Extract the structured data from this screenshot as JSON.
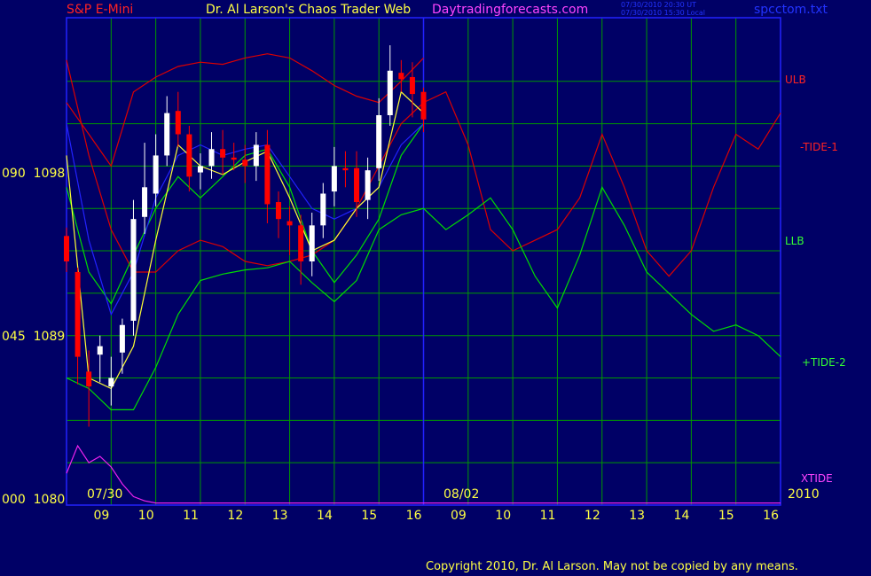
{
  "header": {
    "left": "S&P E-Mini",
    "title": "Dr. Al Larson's Chaos Trader Web",
    "site": "Daytradingforecasts.com",
    "stamp_ut": "07/30/2010 20:30 UT",
    "stamp_local": "07/30/2010 15:30 Local",
    "file": "spcctom.txt"
  },
  "footer": {
    "copyright": "Copyright 2010, Dr. Al Larson. May not be copied by any means."
  },
  "colors": {
    "background": "#000066",
    "grid": "#009900",
    "price_up": "#ffffff",
    "price_down": "#ff0000",
    "blue": "#2222ff",
    "ulb": "#dd0000",
    "llb": "#00dd00",
    "xtide": "#ee22ee",
    "moving_avg": "#ffff33"
  },
  "chart_data": {
    "type": "line",
    "title": "S&P E-Mini",
    "y_axis": {
      "range": [
        1080,
        1103
      ],
      "labels": [
        {
          "tide": "090",
          "price": "1098",
          "value": 1098
        },
        {
          "tide": "045",
          "price": "1089",
          "value": 1089
        },
        {
          "tide": "000",
          "price": "1080",
          "value": 1080
        }
      ]
    },
    "x_axis": {
      "ticks": [
        "09",
        "10",
        "11",
        "12",
        "13",
        "14",
        "15",
        "16",
        "09",
        "10",
        "11",
        "12",
        "13",
        "14",
        "15",
        "16"
      ],
      "dates": [
        "07/30",
        "08/02"
      ],
      "year": "2010"
    },
    "series_labels": [
      "ULB",
      "-TIDE-1",
      "LLB",
      "+TIDE-2",
      "XTIDE"
    ],
    "series": [
      {
        "name": "ULB",
        "x": [
          0,
          0.5,
          1,
          1.5,
          2,
          2.5,
          3,
          3.5,
          4,
          4.5,
          5,
          5.5,
          6,
          6.5,
          7,
          7.5,
          8,
          8.5,
          9,
          9.5,
          10,
          10.5,
          11,
          11.5,
          12,
          12.5,
          13,
          13.5,
          14,
          14.5,
          15,
          15.5,
          16
        ],
        "values": [
          1101,
          1096.5,
          1093,
          1091,
          1091,
          1092,
          1092.5,
          1092.2,
          1091.5,
          1091.3,
          1091.5,
          1091.8,
          1092.5,
          1094,
          1096,
          1098,
          1099,
          1099.5,
          1097,
          1093,
          1092,
          1092.5,
          1093,
          1094.5,
          1097.5,
          1095,
          1092,
          1090.8,
          1092,
          1095,
          1097.5,
          1096.8,
          1098.5
        ]
      },
      {
        "name": "-TIDE-1",
        "x": [
          0,
          0.5,
          1,
          1.5,
          2,
          2.5,
          3,
          3.5,
          4,
          4.5,
          5,
          5.5,
          6,
          6.5,
          7,
          7.5,
          8
        ],
        "values": [
          1099,
          1097.5,
          1096,
          1099.5,
          1100.2,
          1100.7,
          1100.9,
          1100.8,
          1101.1,
          1101.3,
          1101.1,
          1100.5,
          1099.8,
          1099.3,
          1099,
          1100,
          1101.1
        ]
      },
      {
        "name": "LLB",
        "x": [
          0,
          0.5,
          1,
          1.5,
          2,
          2.5,
          3,
          3.5,
          4,
          4.5,
          5,
          5.5,
          6,
          6.5,
          7,
          7.5,
          8,
          8.5,
          9,
          9.5,
          10,
          10.5,
          11,
          11.5,
          12,
          12.5,
          13,
          13.5,
          14,
          14.5,
          15,
          15.5,
          16
        ],
        "values": [
          1086,
          1085.5,
          1084.5,
          1084.5,
          1086.5,
          1089,
          1090.6,
          1090.9,
          1091.1,
          1091.2,
          1091.5,
          1090.5,
          1089.6,
          1090.6,
          1093,
          1093.7,
          1094,
          1093,
          1093.7,
          1094.5,
          1093,
          1090.8,
          1089.3,
          1091.8,
          1095,
          1093.2,
          1091,
          1090,
          1089,
          1088.2,
          1088.5,
          1088,
          1087
        ]
      },
      {
        "name": "+TIDE-2",
        "x": [
          0,
          0.5,
          1,
          1.5,
          2,
          2.5,
          3,
          3.5,
          4,
          4.5,
          5,
          5.5,
          6,
          6.5,
          7,
          7.5,
          8
        ],
        "values": [
          1095,
          1091,
          1089.5,
          1091.8,
          1094,
          1095.5,
          1094.5,
          1095.5,
          1096.5,
          1096.8,
          1095,
          1092,
          1090.5,
          1091.8,
          1093.5,
          1096.5,
          1098
        ]
      },
      {
        "name": "XTIDE",
        "x": [
          0,
          0.25,
          0.5,
          0.75,
          1,
          1.25,
          1.5,
          1.75,
          2,
          2.25,
          2.5,
          2.75,
          3,
          3.25,
          3.5,
          3.75,
          4,
          4.25,
          4.5,
          4.75,
          5,
          5.25,
          5.5,
          5.75,
          6,
          6.25,
          6.5,
          6.75,
          7,
          7.25,
          7.5,
          7.75,
          8,
          8.25,
          8.5,
          8.75,
          9,
          9.25,
          9.5,
          9.75,
          10,
          10.25,
          10.5,
          10.75,
          11,
          11.25,
          11.5,
          11.75,
          12,
          12.25,
          12.5,
          12.75,
          13,
          13.25,
          13.5,
          13.75,
          14,
          14.25,
          14.5,
          14.75,
          15,
          15.25,
          15.5,
          15.75,
          16
        ],
        "values": [
          1081.5,
          1082.8,
          1082,
          1082.3,
          1081.8,
          1081,
          1080.4,
          1080.2,
          1080.1,
          1080.1,
          1080.1,
          1080.1,
          1080.1,
          1080.1,
          1080.1,
          1080.1,
          1080.1,
          1080.1,
          1080.1,
          1080.1,
          1080.1,
          1080.1,
          1080.1,
          1080.1,
          1080.1,
          1080.1,
          1080.1,
          1080.1,
          1080.1,
          1080.1,
          1080.1,
          1080.1,
          1080.1,
          1080.1,
          1080.1,
          1080.1,
          1080.1,
          1080.1,
          1080.1,
          1080.1,
          1080.1,
          1080.1,
          1080.1,
          1080.1,
          1080.1,
          1080.1,
          1080.1,
          1080.1,
          1080.1,
          1080.1,
          1080.1,
          1080.1,
          1080.1,
          1080.1,
          1080.1,
          1080.1,
          1080.1,
          1080.1,
          1080.1,
          1080.1,
          1080.1,
          1080.1,
          1080.1,
          1080.1,
          1080.1
        ]
      },
      {
        "name": "blue",
        "x": [
          0,
          0.5,
          1,
          1.5,
          2,
          2.5,
          3,
          3.5,
          4,
          4.5,
          5,
          5.5,
          6,
          6.5,
          7,
          7.5,
          8
        ],
        "values": [
          1098,
          1092.5,
          1089,
          1091,
          1094.5,
          1096.5,
          1097,
          1096.5,
          1096.8,
          1097,
          1095.5,
          1094,
          1093.5,
          1094,
          1095,
          1097,
          1098
        ]
      },
      {
        "name": "moving_avg",
        "x": [
          0,
          0.5,
          1,
          1.5,
          2,
          2.5,
          3,
          3.5,
          4,
          4.5,
          5,
          5.5,
          6,
          6.5,
          7,
          7.5,
          8
        ],
        "values": [
          1096.5,
          1086,
          1085.5,
          1087.5,
          1092.5,
          1097,
          1096,
          1095.6,
          1096.2,
          1096.7,
          1094.5,
          1092,
          1092.5,
          1094,
          1095,
          1099.5,
          1098.5
        ]
      }
    ],
    "price_bars": {
      "x": [
        0,
        0.25,
        0.5,
        0.75,
        1,
        1.25,
        1.5,
        1.75,
        2,
        2.25,
        2.5,
        2.75,
        3,
        3.25,
        3.5,
        3.75,
        4,
        4.25,
        4.5,
        4.75,
        5,
        5.25,
        5.5,
        5.75,
        6,
        6.25,
        6.5,
        6.75,
        7,
        7.25,
        7.5,
        7.75,
        8
      ],
      "open": [
        1092.7,
        1091.0,
        1086.3,
        1087.1,
        1085.6,
        1087.2,
        1088.7,
        1093.6,
        1094.7,
        1096.5,
        1098.6,
        1097.5,
        1095.7,
        1096.0,
        1096.8,
        1096.4,
        1096.3,
        1096.0,
        1097.0,
        1094.3,
        1093.4,
        1093.2,
        1091.5,
        1093.2,
        1094.8,
        1095.9,
        1095.9,
        1094.4,
        1095.9,
        1098.4,
        1100.4,
        1100.2,
        1099.5
      ],
      "close": [
        1091.5,
        1087.0,
        1085.6,
        1087.5,
        1086.0,
        1088.5,
        1093.5,
        1095.0,
        1096.5,
        1098.5,
        1097.5,
        1095.5,
        1096.0,
        1096.8,
        1096.4,
        1096.3,
        1096.0,
        1097.0,
        1094.2,
        1093.5,
        1093.2,
        1091.5,
        1093.2,
        1094.7,
        1096.0,
        1095.8,
        1094.3,
        1095.8,
        1098.4,
        1100.5,
        1100.1,
        1099.4,
        1098.2
      ],
      "high": [
        1093.1,
        1091.2,
        1087.3,
        1088.0,
        1087.0,
        1088.8,
        1094.4,
        1097.1,
        1097.5,
        1099.3,
        1099.5,
        1097.9,
        1096.6,
        1097.6,
        1097.7,
        1097.1,
        1097.0,
        1097.6,
        1097.7,
        1094.8,
        1094.1,
        1093.7,
        1093.8,
        1095.2,
        1096.9,
        1096.7,
        1096.7,
        1096.4,
        1099.2,
        1101.7,
        1101.0,
        1100.9,
        1099.7
      ],
      "low": [
        1091.0,
        1085.7,
        1083.7,
        1085.8,
        1084.7,
        1086.2,
        1088.0,
        1092.8,
        1094.1,
        1096.0,
        1096.9,
        1094.8,
        1094.9,
        1095.4,
        1095.6,
        1095.8,
        1095.2,
        1095.3,
        1093.3,
        1092.6,
        1091.8,
        1090.4,
        1090.8,
        1092.6,
        1094.1,
        1095.0,
        1093.6,
        1093.5,
        1095.3,
        1097.9,
        1099.5,
        1098.3,
        1097.6
      ]
    }
  }
}
